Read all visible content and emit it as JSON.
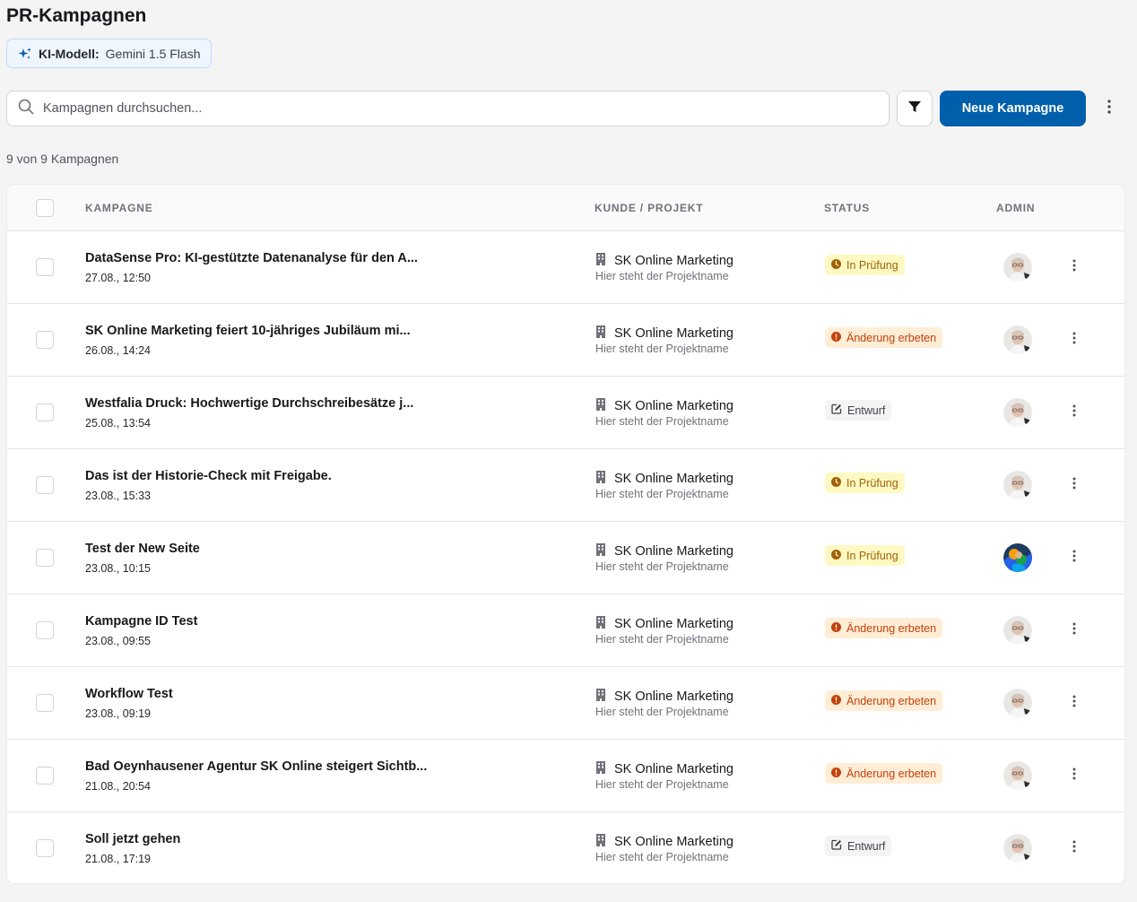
{
  "page": {
    "title": "PR-Kampagnen"
  },
  "model_badge": {
    "label": "KI-Modell:",
    "value": "Gemini 1.5 Flash",
    "icon": "sparkles-icon"
  },
  "search": {
    "placeholder": "Kampagnen durchsuchen...",
    "value": ""
  },
  "toolbar": {
    "new_label": "Neue Kampagne",
    "accent": "#005fab"
  },
  "count_text": "9 von 9 Kampagnen",
  "table": {
    "headers": {
      "campaign": "KAMPAGNE",
      "client": "KUNDE / PROJEKT",
      "status": "STATUS",
      "admin": "ADMIN"
    },
    "rows": [
      {
        "title": "DataSense Pro: KI-gestützte Datenanalyse für den A...",
        "date": "27.08., 12:50",
        "client": "SK Online Marketing",
        "project": "Hier steht der Projektname",
        "status": "In Prüfung",
        "status_type": "review",
        "avatar": "avatar-photo-man"
      },
      {
        "title": "SK Online Marketing feiert 10-jähriges Jubiläum mi...",
        "date": "26.08., 14:24",
        "client": "SK Online Marketing",
        "project": "Hier steht der Projektname",
        "status": "Änderung erbeten",
        "status_type": "change",
        "avatar": "avatar-photo-man"
      },
      {
        "title": "Westfalia Druck: Hochwertige Durchschreibesätze j...",
        "date": "25.08., 13:54",
        "client": "SK Online Marketing",
        "project": "Hier steht der Projektname",
        "status": "Entwurf",
        "status_type": "draft",
        "avatar": "avatar-photo-man"
      },
      {
        "title": "Das ist der Historie-Check mit Freigabe.",
        "date": "23.08., 15:33",
        "client": "SK Online Marketing",
        "project": "Hier steht der Projektname",
        "status": "In Prüfung",
        "status_type": "review",
        "avatar": "avatar-photo-man"
      },
      {
        "title": "Test der New Seite",
        "date": "23.08., 10:15",
        "client": "SK Online Marketing",
        "project": "Hier steht der Projektname",
        "status": "In Prüfung",
        "status_type": "review",
        "avatar": "avatar-photo-colorful"
      },
      {
        "title": "Kampagne ID Test",
        "date": "23.08., 09:55",
        "client": "SK Online Marketing",
        "project": "Hier steht der Projektname",
        "status": "Änderung erbeten",
        "status_type": "change",
        "avatar": "avatar-photo-man"
      },
      {
        "title": "Workflow Test",
        "date": "23.08., 09:19",
        "client": "SK Online Marketing",
        "project": "Hier steht der Projektname",
        "status": "Änderung erbeten",
        "status_type": "change",
        "avatar": "avatar-photo-man"
      },
      {
        "title": "Bad Oeynhausener Agentur SK Online steigert Sichtb...",
        "date": "21.08., 20:54",
        "client": "SK Online Marketing",
        "project": "Hier steht der Projektname",
        "status": "Änderung erbeten",
        "status_type": "change",
        "avatar": "avatar-photo-man"
      },
      {
        "title": "Soll jetzt gehen",
        "date": "21.08., 17:19",
        "client": "SK Online Marketing",
        "project": "Hier steht der Projektname",
        "status": "Entwurf",
        "status_type": "draft",
        "avatar": "avatar-photo-man"
      }
    ]
  }
}
